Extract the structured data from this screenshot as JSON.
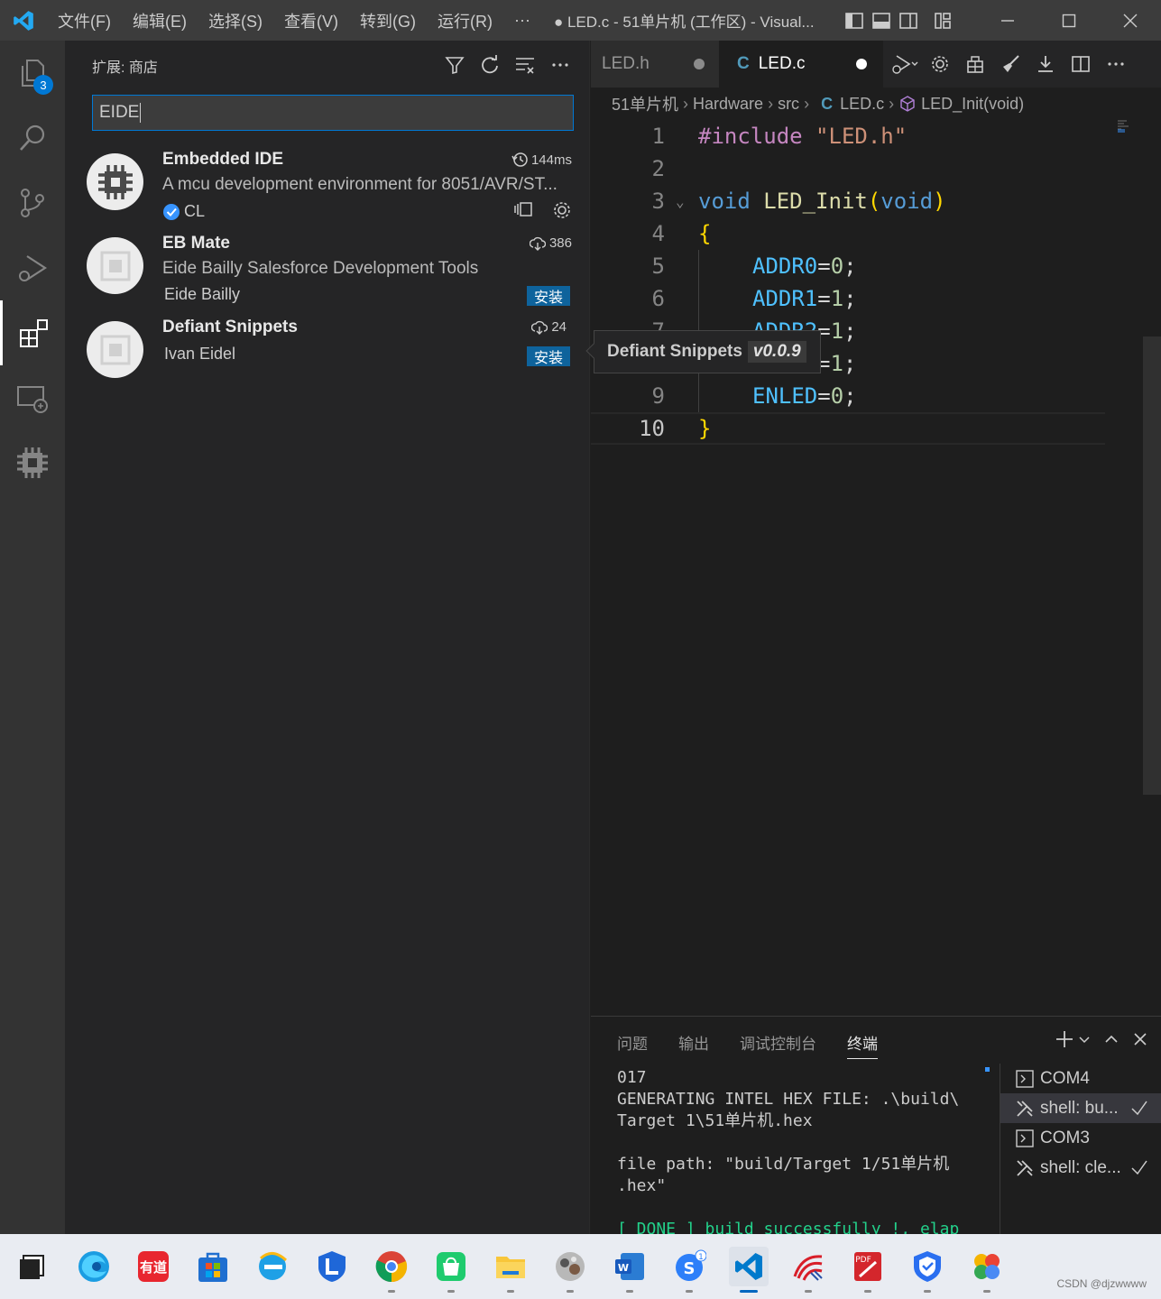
{
  "titlebar": {
    "menu": [
      "文件(F)",
      "编辑(E)",
      "选择(S)",
      "查看(V)",
      "转到(G)",
      "运行(R)",
      "···"
    ],
    "title": "● LED.c - 51单片机 (工作区) - Visual..."
  },
  "activity": {
    "explorer_badge": "3"
  },
  "sidebar": {
    "title": "扩展: 商店",
    "search_value": "EIDE",
    "extensions": [
      {
        "name": "Embedded IDE",
        "description": "A mcu development environment for 8051/AVR/ST...",
        "publisher": "CL",
        "stat": "144ms",
        "stat_icon": "history-icon"
      },
      {
        "name": "EB Mate",
        "description": "Eide Bailly Salesforce Development Tools",
        "publisher": "Eide Bailly",
        "stat": "386",
        "stat_icon": "cloud-download-icon",
        "action": "安装"
      },
      {
        "name": "Defiant Snippets",
        "description": "",
        "publisher": "Ivan Eidel",
        "stat": "24",
        "stat_icon": "cloud-download-icon",
        "action": "安装"
      }
    ]
  },
  "editor": {
    "tabs": [
      {
        "label": "LED.h",
        "active": false
      },
      {
        "label": "LED.c",
        "active": true
      }
    ],
    "breadcrumbs": [
      "51单片机",
      "Hardware",
      "src",
      "LED.c",
      "LED_Init(void)"
    ],
    "lines": [
      "1",
      "2",
      "3",
      "4",
      "5",
      "6",
      "7",
      "8",
      "9",
      "10"
    ],
    "code": {
      "l1_kw": "#include",
      "l1_str": "\"LED.h\"",
      "l3_type": "void",
      "l3_fn": "LED_Init",
      "l3_open": "(",
      "l3_arg": "void",
      "l3_close": ")",
      "l4": "{",
      "l5_var": "ADDR0",
      "l5_eq": "=",
      "l5_num": "0",
      "l5_semi": ";",
      "l6_var": "ADDR1",
      "l6_eq": "=",
      "l6_num": "1",
      "l6_semi": ";",
      "l7_var": "ADDR2",
      "l7_eq": "=",
      "l7_num": "1",
      "l7_semi": ";",
      "l8_eq": "=",
      "l8_num": "1",
      "l8_semi": ";",
      "l9_var": "ENLED",
      "l9_eq": "=",
      "l9_num": "0",
      "l9_semi": ";",
      "l10": "}"
    },
    "tooltip": {
      "name": "Defiant Snippets",
      "version": "v0.0.9"
    }
  },
  "panel": {
    "tabs": [
      "问题",
      "输出",
      "调试控制台",
      "终端"
    ],
    "terminal_lines": [
      "017",
      "GENERATING INTEL HEX FILE: .\\build\\",
      "Target 1\\51单片机.hex",
      "",
      "file path: \"build/Target 1/51单片机",
      ".hex\"",
      ""
    ],
    "done_line": "[ DONE ] build successfully !, elap",
    "terminals": [
      {
        "label": "COM4",
        "icon": "terminal-icon"
      },
      {
        "label": "shell: bu...",
        "icon": "tools-icon",
        "selected": true
      },
      {
        "label": "COM3",
        "icon": "terminal-icon"
      },
      {
        "label": "shell: cle...",
        "icon": "tools-icon"
      }
    ]
  },
  "taskbar": {
    "youdao_label": "有道",
    "pdf_label": "PDF",
    "watermark": "CSDN @djzwwww"
  }
}
